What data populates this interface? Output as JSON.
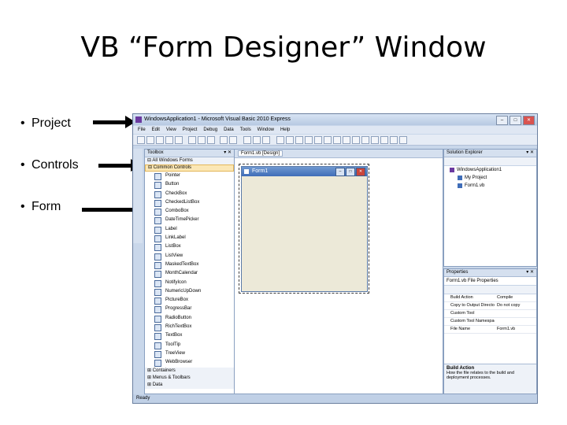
{
  "slide": {
    "title": "VB “Form Designer” Window",
    "bullets": [
      "Project",
      "Controls",
      "Form"
    ],
    "bullet_symbol": "•"
  },
  "ide": {
    "window_title": "WindowsApplication1 - Microsoft Visual Basic 2010 Express",
    "window_buttons": [
      "–",
      "□",
      "✕"
    ],
    "menu": [
      "File",
      "Edit",
      "View",
      "Project",
      "Debug",
      "Data",
      "Tools",
      "Window",
      "Help"
    ],
    "toolbox": {
      "header": "Toolbox",
      "pin": "▾ ✕",
      "top_group": "⊟ All Windows Forms",
      "selected_group": "⊟ Common Controls",
      "items": [
        "Pointer",
        "Button",
        "CheckBox",
        "CheckedListBox",
        "ComboBox",
        "DateTimePicker",
        "Label",
        "LinkLabel",
        "ListBox",
        "ListView",
        "MaskedTextBox",
        "MonthCalendar",
        "NotifyIcon",
        "NumericUpDown",
        "PictureBox",
        "ProgressBar",
        "RadioButton",
        "RichTextBox",
        "TextBox",
        "ToolTip",
        "TreeView",
        "WebBrowser"
      ],
      "bottom_groups": [
        "⊞ Containers",
        "⊞ Menus & Toolbars",
        "⊞ Data"
      ]
    },
    "designer": {
      "tab": "Form1.vb [Design]",
      "form_title": "Form1",
      "form_buttons": [
        "–",
        "□",
        "✕"
      ]
    },
    "solution_explorer": {
      "header": "Solution Explorer",
      "pin": "▾ ✕",
      "root": "WindowsApplication1",
      "children": [
        "My Project",
        "Form1.vb"
      ]
    },
    "properties": {
      "header": "Properties",
      "pin": "▾ ✕",
      "selector": "Form1.vb File Properties",
      "rows": [
        {
          "name": "Build Action",
          "value": "Compile"
        },
        {
          "name": "Copy to Output Directory",
          "value": "Do not copy"
        },
        {
          "name": "Custom Tool",
          "value": ""
        },
        {
          "name": "Custom Tool Namespace",
          "value": ""
        },
        {
          "name": "File Name",
          "value": "Form1.vb"
        }
      ],
      "description_title": "Build Action",
      "description_text": "How the file relates to the build and deployment processes."
    },
    "status": "Ready"
  }
}
